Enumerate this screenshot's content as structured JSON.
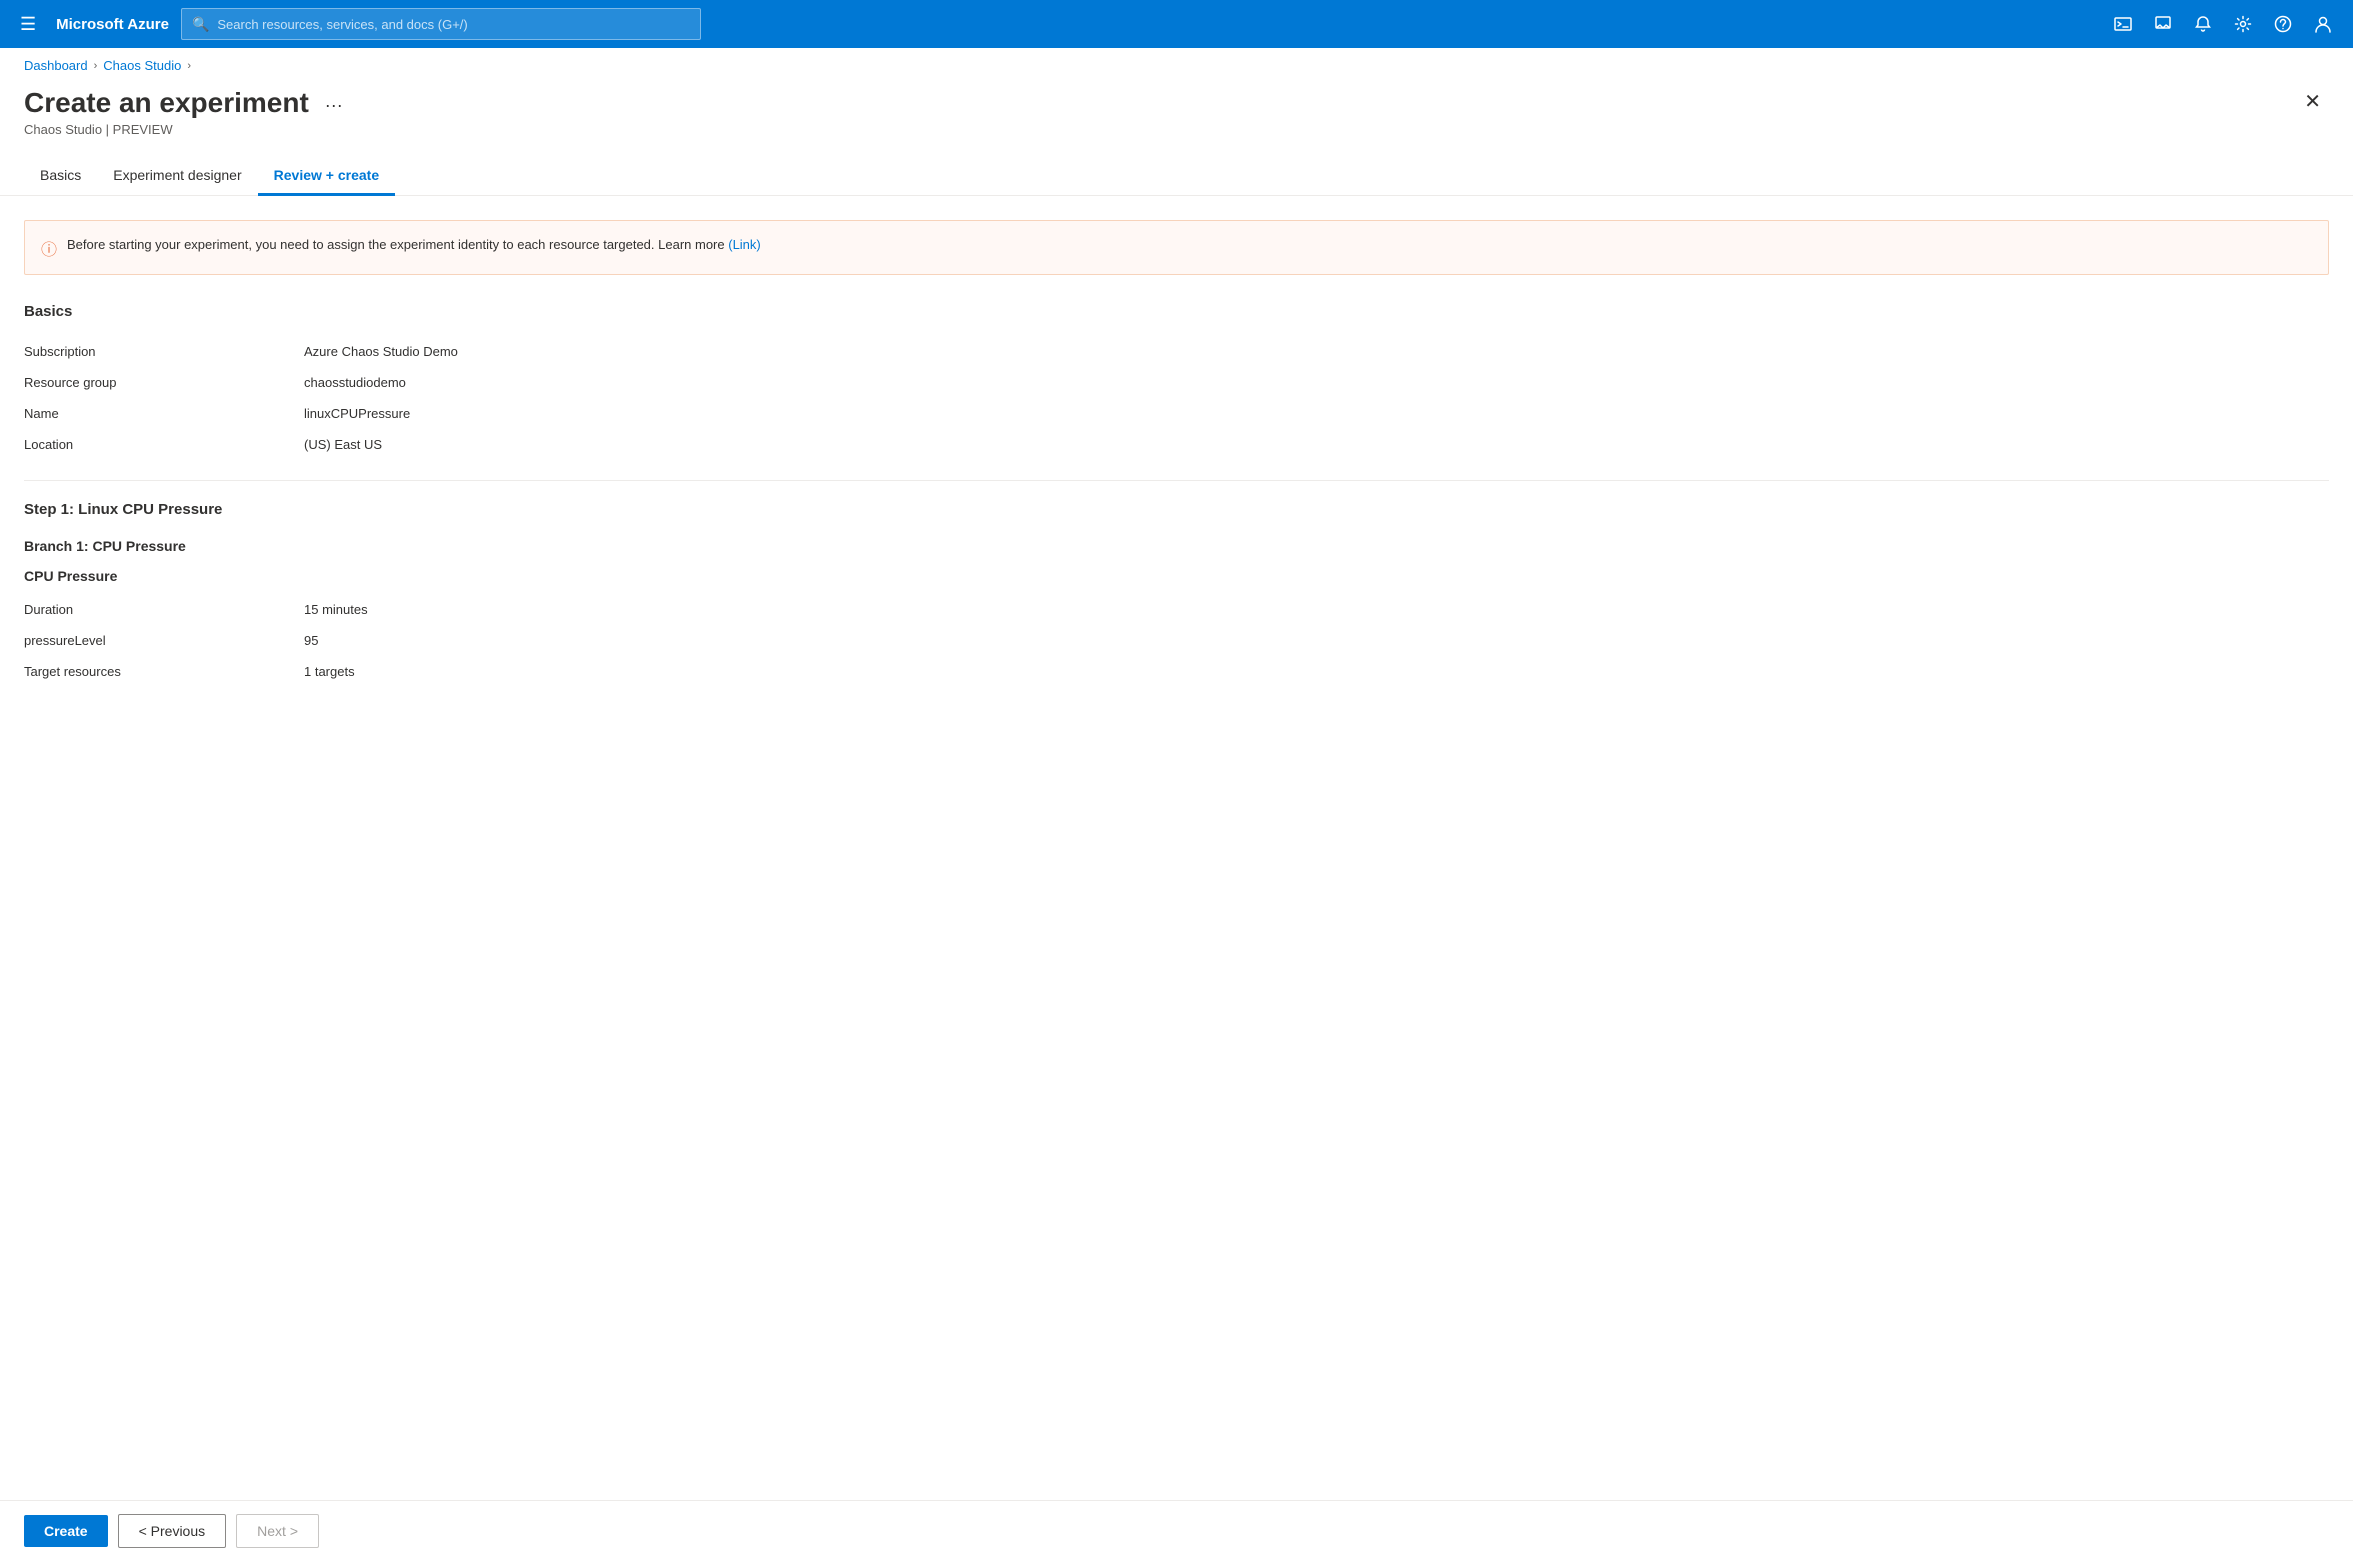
{
  "topbar": {
    "app_name": "Microsoft Azure",
    "search_placeholder": "Search resources, services, and docs (G+/)"
  },
  "breadcrumb": {
    "items": [
      {
        "label": "Dashboard",
        "link": true
      },
      {
        "label": "Chaos Studio",
        "link": true
      }
    ]
  },
  "page": {
    "title": "Create an experiment",
    "subtitle": "Chaos Studio | PREVIEW",
    "more_label": "···"
  },
  "tabs": [
    {
      "label": "Basics",
      "active": false
    },
    {
      "label": "Experiment designer",
      "active": false
    },
    {
      "label": "Review + create",
      "active": true
    }
  ],
  "warning": {
    "text": "Before starting your experiment, you need to assign the experiment identity to each resource targeted. Learn more",
    "link_label": "(Link)"
  },
  "basics_section": {
    "title": "Basics",
    "fields": [
      {
        "label": "Subscription",
        "value": "Azure Chaos Studio Demo"
      },
      {
        "label": "Resource group",
        "value": "chaosstudiodemo"
      },
      {
        "label": "Name",
        "value": "linuxCPUPressure"
      },
      {
        "label": "Location",
        "value": "(US) East US"
      }
    ]
  },
  "step1": {
    "title": "Step 1: Linux CPU Pressure",
    "branch1": {
      "title": "Branch 1: CPU Pressure",
      "fault": {
        "title": "CPU Pressure",
        "fields": [
          {
            "label": "Duration",
            "value": "15 minutes"
          },
          {
            "label": "pressureLevel",
            "value": "95"
          },
          {
            "label": "Target resources",
            "value": "1 targets"
          }
        ]
      }
    }
  },
  "footer": {
    "create_label": "Create",
    "previous_label": "< Previous",
    "next_label": "Next >"
  }
}
